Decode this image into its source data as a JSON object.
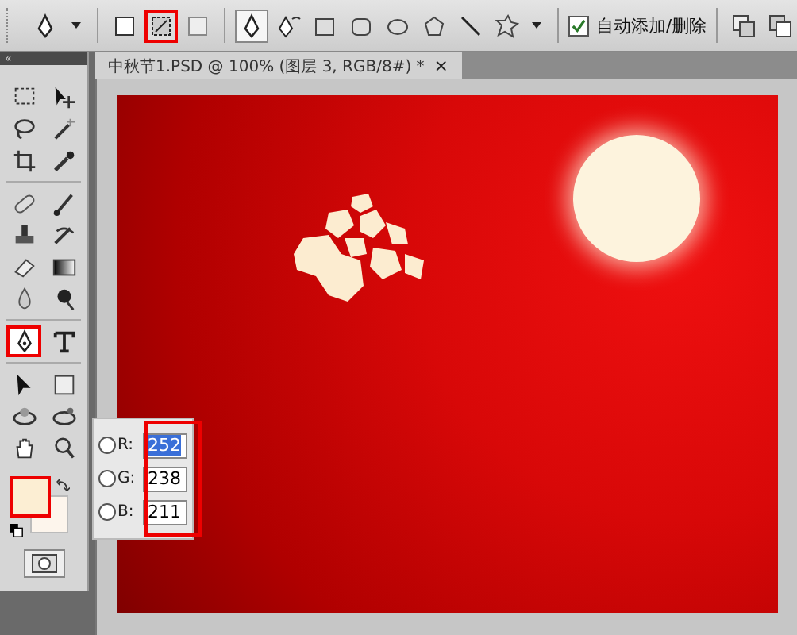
{
  "options_bar": {
    "modes": [
      {
        "selected": false
      },
      {
        "selected": true
      },
      {
        "selected": false
      }
    ],
    "draw_tools": [
      {
        "selected": true
      },
      {
        "selected": false
      },
      {
        "selected": false
      },
      {
        "selected": false
      },
      {
        "selected": false
      },
      {
        "selected": false
      },
      {
        "selected": false
      },
      {
        "selected": false
      }
    ],
    "auto_add": {
      "label": "自动添加/删除",
      "checked": true
    }
  },
  "toolbox": {
    "collapse": "«",
    "tools": [
      {
        "selected": false
      },
      {
        "selected": false
      },
      {
        "selected": false
      },
      {
        "selected": false
      },
      {
        "selected": false
      },
      {
        "selected": false
      },
      {
        "selected": false
      },
      {
        "selected": false
      },
      {
        "selected": false
      },
      {
        "selected": false
      },
      {
        "selected": false
      },
      {
        "selected": false
      },
      {
        "selected": false
      },
      {
        "selected": false
      },
      {
        "selected": true
      },
      {
        "selected": false
      },
      {
        "selected": false
      },
      {
        "selected": false
      },
      {
        "selected": false
      },
      {
        "selected": false
      },
      {
        "selected": false
      },
      {
        "selected": false
      }
    ],
    "foreground": {
      "color": "#fceed3"
    },
    "background": {
      "color": "#fdf5ec"
    }
  },
  "document": {
    "tab": "中秋节1.PSD @ 100% (图层 3, RGB/8#) *",
    "close": "×"
  },
  "color_fields": [
    {
      "label": "R:",
      "value": "252",
      "checked": false,
      "selected": true
    },
    {
      "label": "G:",
      "value": "238",
      "checked": false,
      "selected": false
    },
    {
      "label": "B:",
      "value": "211",
      "checked": false,
      "selected": false
    }
  ]
}
